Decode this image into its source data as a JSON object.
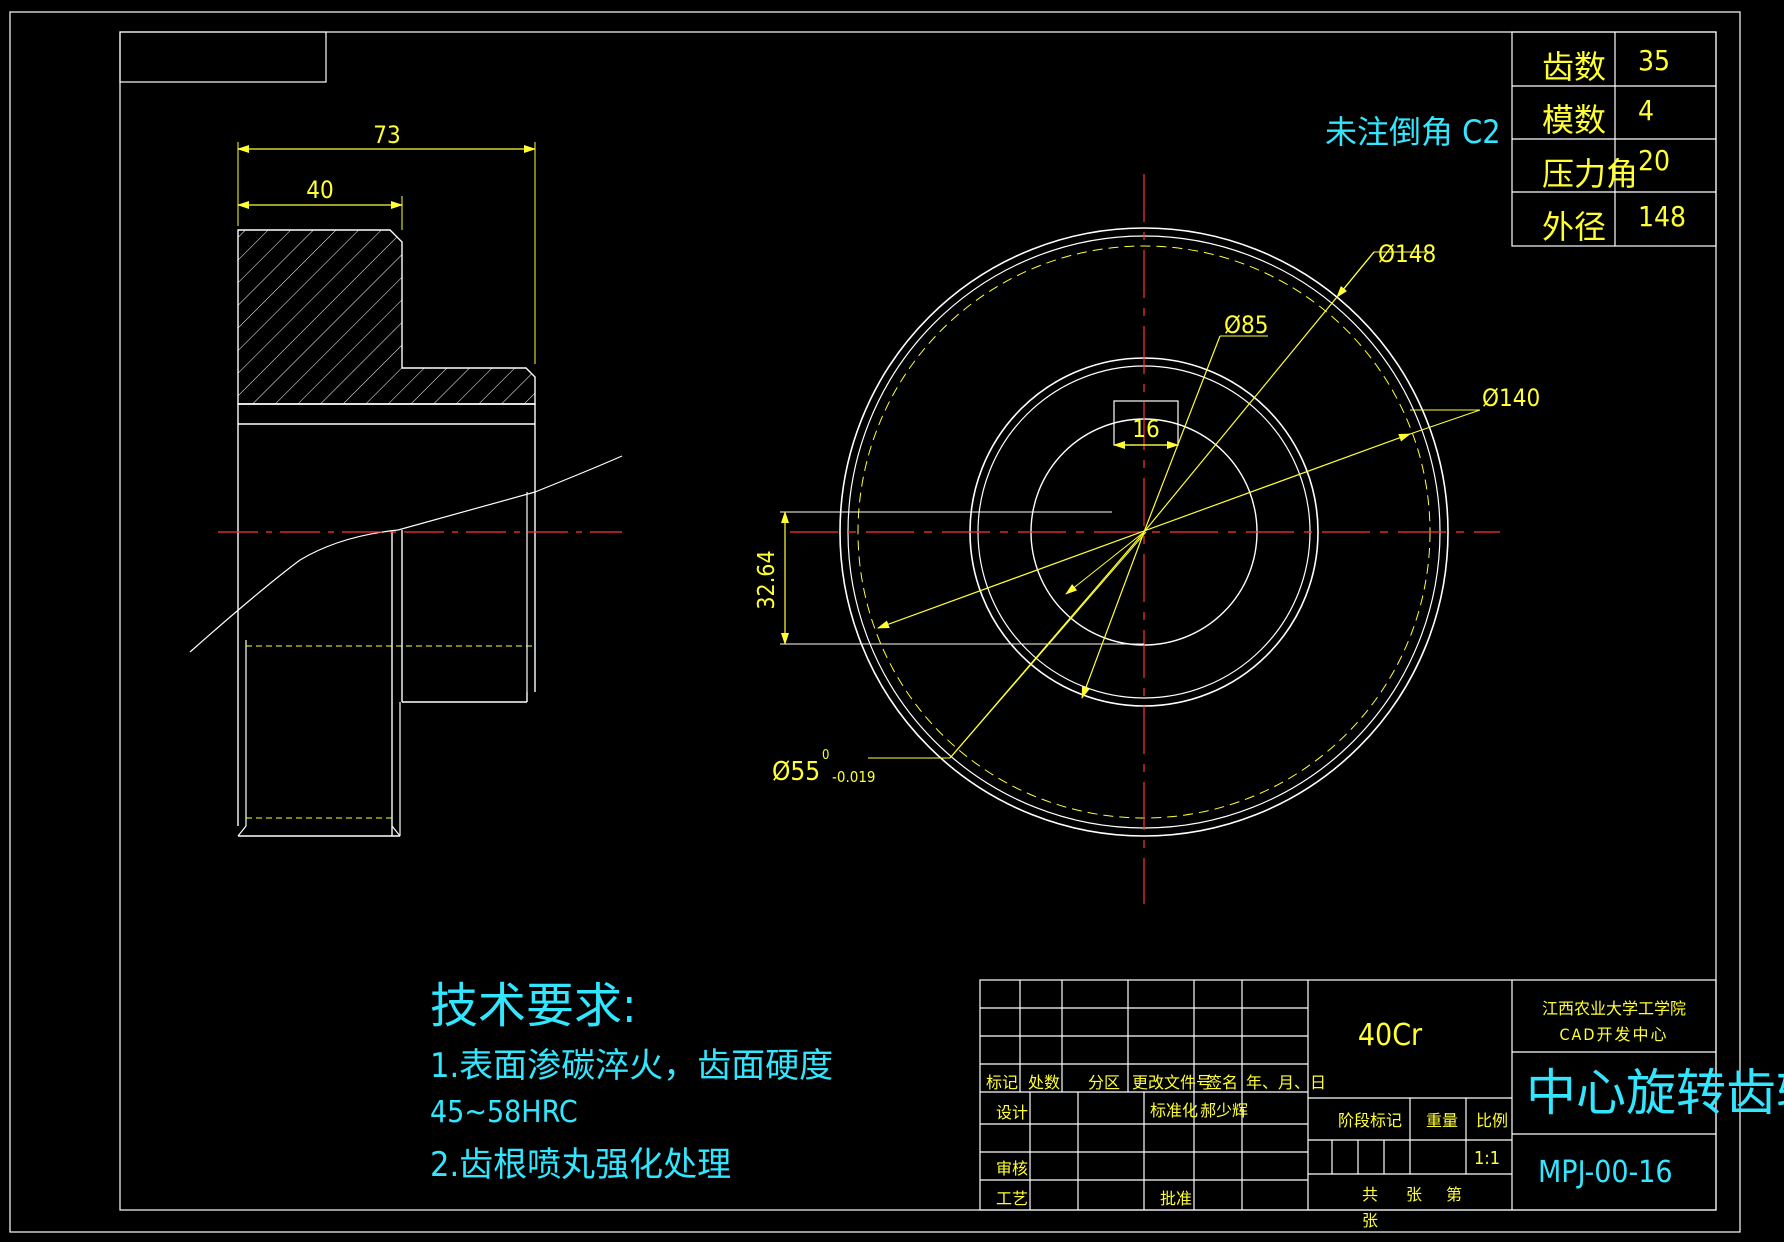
{
  "gear_params": [
    {
      "label": "齿数",
      "value": "35"
    },
    {
      "label": "模数",
      "value": "4"
    },
    {
      "label": "压力角",
      "value": "20"
    },
    {
      "label": "外径",
      "value": "148"
    }
  ],
  "chamfer_note": "未注倒角 C2",
  "dimensions": {
    "width_total": "73",
    "width_hub": "40",
    "keyway_depth": "32.64",
    "keyway_width": "16",
    "dia_outer": "Ø148",
    "dia_hub": "Ø85",
    "dia_pitch": "Ø140",
    "dia_bore": "Ø55",
    "bore_tol_upper": "0",
    "bore_tol_lower": "-0.019"
  },
  "tech_requirements": {
    "title": "技术要求:",
    "item1_line1": "1.表面渗碳淬火，齿面硬度",
    "item1_line2": "45~58HRC",
    "item2": "2.齿根喷丸强化处理"
  },
  "title_block": {
    "material": "40Cr",
    "org_line1": "江西农业大学工学院",
    "org_line2": "CAD开发中心",
    "part_name": "中心旋转齿轮",
    "drawing_no": "MPJ-00-16",
    "scale": "1:1",
    "labels": {
      "mark": "标记",
      "count": "处数",
      "zone": "分区",
      "change_doc": "更改文件号",
      "signature": "签名",
      "date": "年、月、日",
      "design": "设计",
      "standardize": "标准化",
      "designer": "郝少辉",
      "review": "审核",
      "process": "工艺",
      "approve": "批准",
      "stage_mark": "阶段标记",
      "weight": "重量",
      "ratio": "比例",
      "total": "共",
      "sheet_unit": "张",
      "sheet_no": "第",
      "sheet_unit2": "张"
    }
  },
  "colors": {
    "background": "#000000",
    "outline": "#ffffff",
    "dimension": "#ffff33",
    "centerline": "#ff3333",
    "text_cyan": "#33e6ff"
  }
}
